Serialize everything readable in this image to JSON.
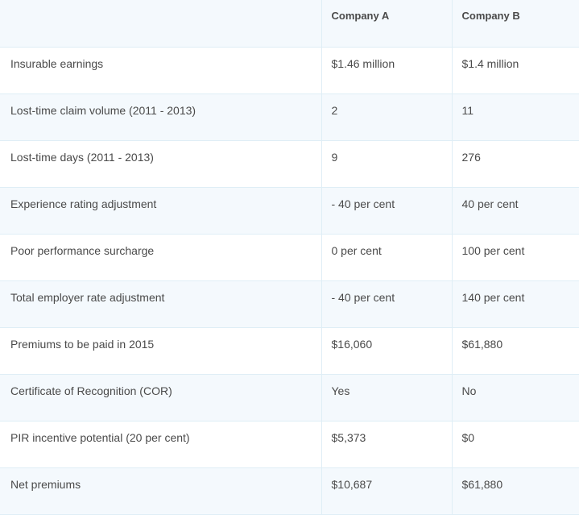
{
  "header": {
    "corner": "",
    "company_a": "Company A",
    "company_b": "Company B"
  },
  "rows": [
    {
      "label": "Insurable earnings",
      "a": "$1.46 million",
      "b": "$1.4 million"
    },
    {
      "label": "Lost-time claim volume (2011 - 2013)",
      "a": "2",
      "b": "11"
    },
    {
      "label": "Lost-time days (2011 - 2013)",
      "a": "9",
      "b": "276"
    },
    {
      "label": "Experience rating adjustment",
      "a": "- 40 per cent",
      "b": "40 per cent"
    },
    {
      "label": "Poor performance surcharge",
      "a": "0 per cent",
      "b": "100 per cent"
    },
    {
      "label": "Total employer rate adjustment",
      "a": "- 40 per cent",
      "b": "140 per cent"
    },
    {
      "label": "Premiums to be paid in 2015",
      "a": "$16,060",
      "b": "$61,880"
    },
    {
      "label": "Certificate of Recognition (COR)",
      "a": "Yes",
      "b": "No"
    },
    {
      "label": "PIR incentive potential (20 per cent)",
      "a": "$5,373",
      "b": "$0"
    },
    {
      "label": "Net premiums",
      "a": "$10,687",
      "b": "$61,880"
    }
  ]
}
